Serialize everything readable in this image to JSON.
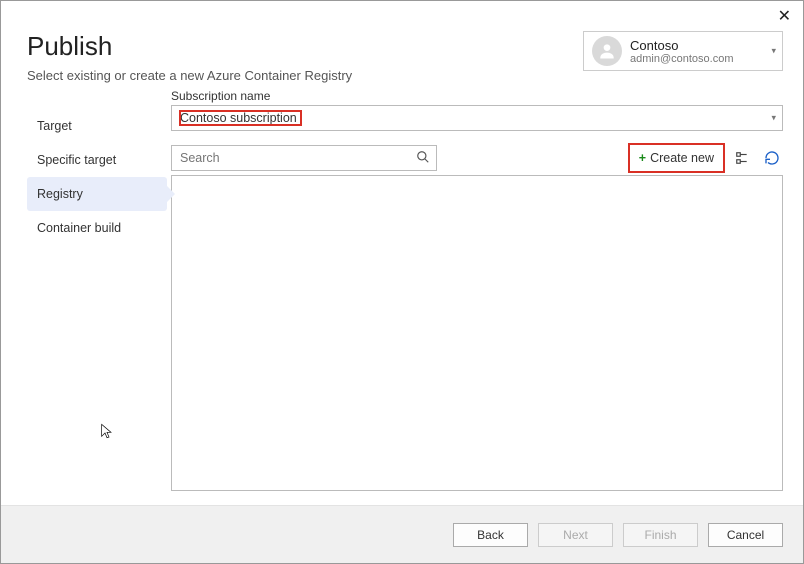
{
  "header": {
    "title": "Publish",
    "subtitle": "Select existing or create a new Azure Container Registry"
  },
  "account": {
    "name": "Contoso",
    "email": "admin@contoso.com"
  },
  "sidebar": {
    "items": [
      {
        "label": "Target"
      },
      {
        "label": "Specific target"
      },
      {
        "label": "Registry"
      },
      {
        "label": "Container build"
      }
    ],
    "active_index": 2
  },
  "main": {
    "subscription_label": "Subscription name",
    "subscription_value": "Contoso subscription",
    "search_placeholder": "Search",
    "create_new_label": "Create new"
  },
  "footer": {
    "back": "Back",
    "next": "Next",
    "finish": "Finish",
    "cancel": "Cancel"
  }
}
